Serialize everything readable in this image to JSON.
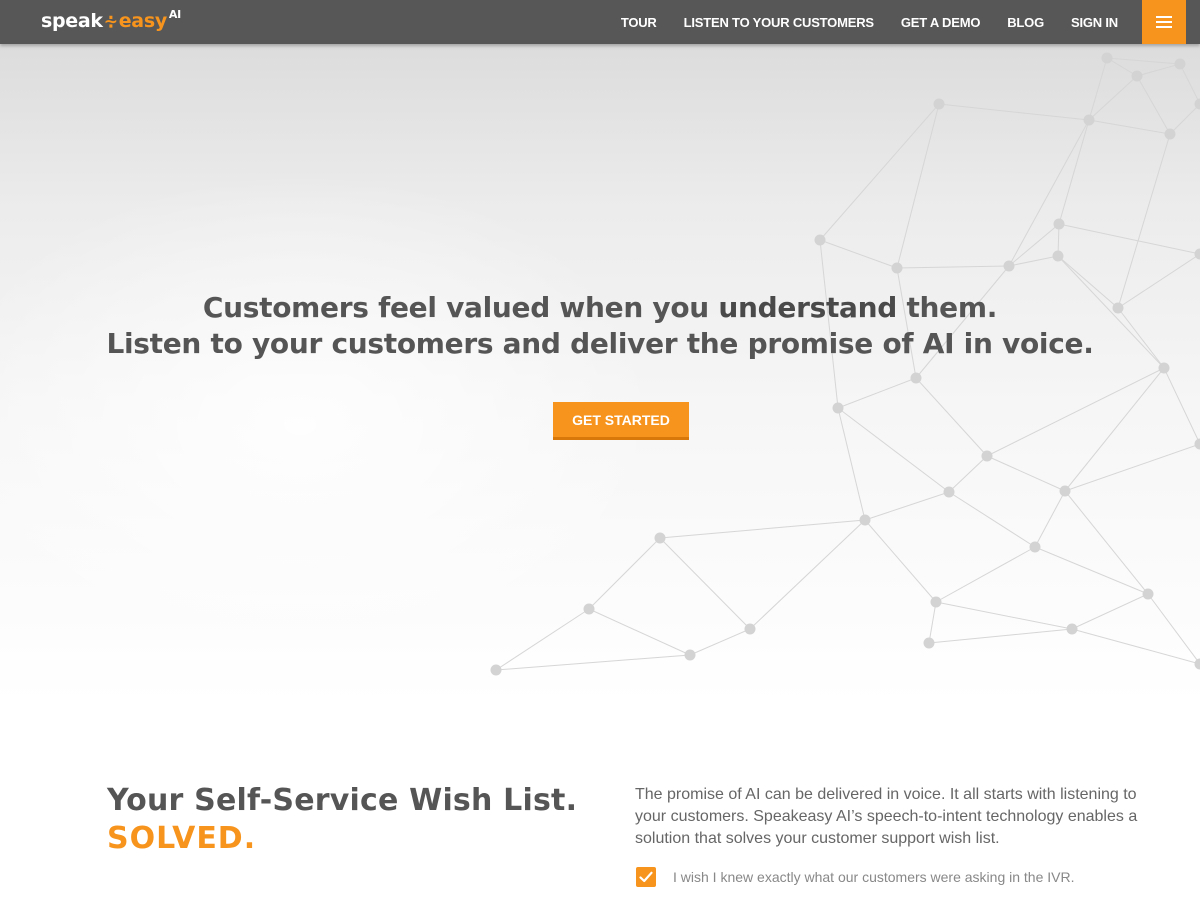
{
  "header": {
    "logo": {
      "word1": "speak",
      "mark": "∻",
      "word2": "easy",
      "suffix": "AI"
    },
    "nav": [
      "TOUR",
      "LISTEN TO YOUR CUSTOMERS",
      "GET A DEMO",
      "BLOG",
      "SIGN IN"
    ],
    "menu_icon": "hamburger-icon"
  },
  "hero": {
    "line1_before": "Customers feel valued when you ",
    "line1_bold": "understand",
    "line1_after": " them.",
    "line2": "Listen to your customers and deliver the promise of AI in voice.",
    "cta_label": "GET STARTED"
  },
  "wishlist": {
    "title": "Your Self-Service Wish List.",
    "solved": "SOLVED.",
    "intro": "The promise of AI can be delivered in voice. It all starts with listening to your customers. Speakeasy AI’s speech-to-intent technology enables a solution that solves your customer support wish list.",
    "items": [
      {
        "text": "I wish I knew exactly what our customers were asking in the IVR.",
        "checked": true
      }
    ]
  },
  "colors": {
    "accent": "#f7941d",
    "header_bg": "#575757"
  }
}
